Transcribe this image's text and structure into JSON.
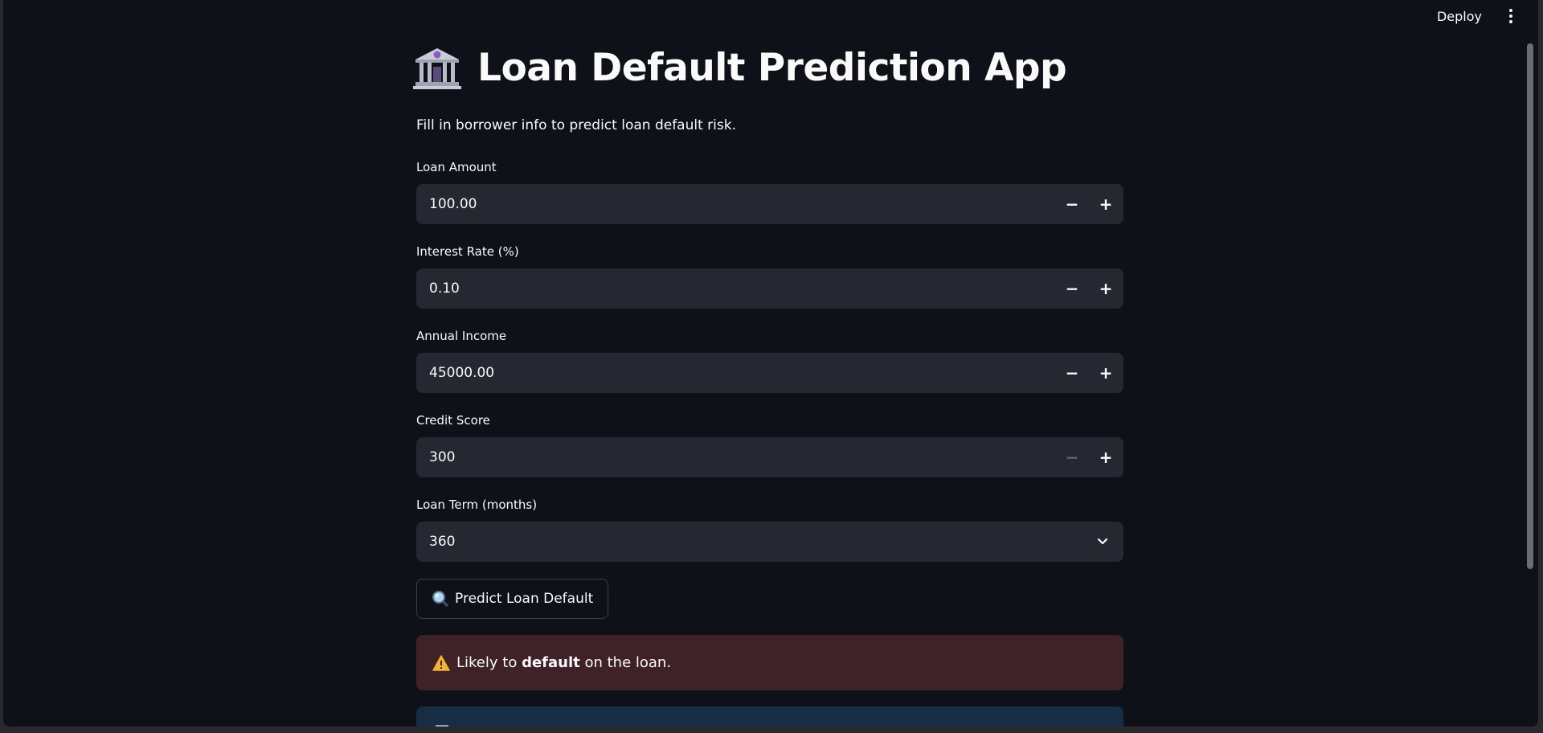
{
  "header": {
    "deploy_label": "Deploy"
  },
  "page": {
    "title": "Loan Default Prediction App",
    "subtitle": "Fill in borrower info to predict loan default risk."
  },
  "form": {
    "loan_amount": {
      "label": "Loan Amount",
      "value": "100.00",
      "minus": "−",
      "plus": "+"
    },
    "interest_rate": {
      "label": "Interest Rate (%)",
      "value": "0.10",
      "minus": "−",
      "plus": "+"
    },
    "annual_income": {
      "label": "Annual Income",
      "value": "45000.00",
      "minus": "−",
      "plus": "+"
    },
    "credit_score": {
      "label": "Credit Score",
      "value": "300",
      "minus": "−",
      "plus": "+"
    },
    "loan_term": {
      "label": "Loan Term (months)",
      "selected": "360"
    }
  },
  "predict_button": {
    "label": "Predict Loan Default"
  },
  "result": {
    "prefix": "Likely to ",
    "emphasis": "default",
    "suffix": " on the loan."
  },
  "colors": {
    "background": "#0e1117",
    "input_bg": "#262730",
    "error_bg": "#3e2228",
    "info_bg": "#172d43"
  },
  "icons": {
    "title": "bank-icon",
    "button": "magnifier-icon",
    "alert": "warning-icon",
    "select": "chevron-down-icon",
    "menu": "kebab-menu-icon"
  }
}
